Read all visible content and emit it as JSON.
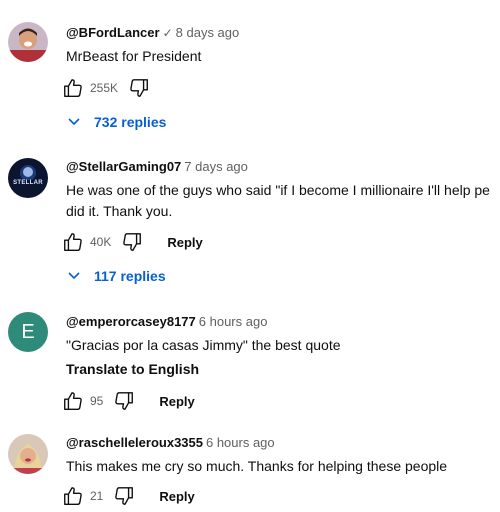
{
  "comments": [
    {
      "handle": "@BFordLancer",
      "verified_mark": "✓",
      "time": "8 days ago",
      "text": "MrBeast for President",
      "likes": "255K",
      "replies_label": "732 replies",
      "avatar": "photo-avatar-man"
    },
    {
      "handle": "@StellarGaming07",
      "time": "7 days ago",
      "text_line1": "He was one of the guys who said \"if I become I millionaire I'll help pe",
      "text_line2": "did it. Thank you.",
      "likes": "40K",
      "reply_label": "Reply",
      "replies_label": "117 replies",
      "avatar_text": "STELLAR"
    },
    {
      "handle": "@emperorcasey8177",
      "time": "6 hours ago",
      "text": "\"Gracias por la casas Jimmy\" the best quote",
      "translate_label": "Translate to English",
      "likes": "95",
      "reply_label": "Reply",
      "avatar_letter": "E",
      "avatar_color": "#2e8b7a"
    },
    {
      "handle": "@raschelleleroux3355",
      "time": "6 hours ago",
      "text": "This makes me cry so much. Thanks for helping these people",
      "likes": "21",
      "reply_label": "Reply",
      "avatar": "photo-avatar-woman"
    }
  ],
  "colors": {
    "link_blue": "#065fd4",
    "muted": "#606060",
    "text": "#0f0f0f"
  }
}
